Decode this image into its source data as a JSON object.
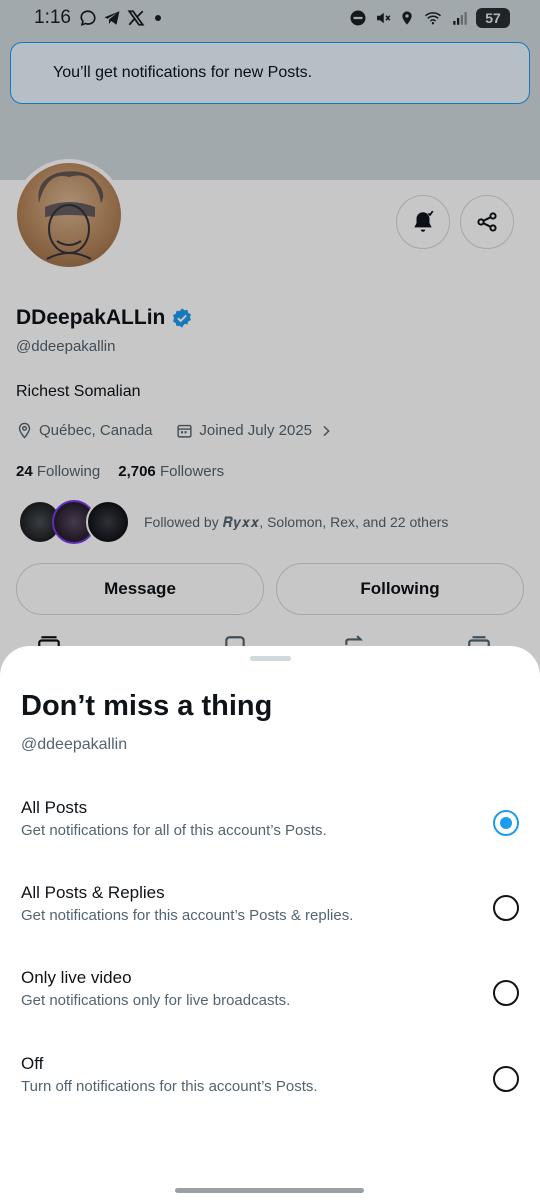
{
  "status_bar": {
    "time": "1:16",
    "battery": "57"
  },
  "toast": {
    "text": "You’ll get notifications for new Posts."
  },
  "profile": {
    "display_name": "DDeepakALLin",
    "handle": "@ddeepakallin",
    "bio": "Richest Somalian",
    "location": "Québec, Canada",
    "joined": "Joined July 2025",
    "following_count": "24",
    "following_label": "Following",
    "followers_count": "2,706",
    "followers_label": "Followers",
    "followed_by": "Followed by 𝑹𝒚𝒙𝒙, Solomon, Rex, and 22 others",
    "message_label": "Message",
    "following_button_label": "Following",
    "verified_color": "#1d9bf0"
  },
  "sheet": {
    "title": "Don’t miss a thing",
    "subtitle": "@ddeepakallin",
    "options": [
      {
        "title": "All Posts",
        "desc": "Get notifications for all of this account’s Posts.",
        "selected": true
      },
      {
        "title": "All Posts & Replies",
        "desc": "Get notifications for this account’s Posts & replies.",
        "selected": false
      },
      {
        "title": "Only live video",
        "desc": "Get notifications only for live broadcasts.",
        "selected": false
      },
      {
        "title": "Off",
        "desc": "Turn off notifications for this account’s Posts.",
        "selected": false
      }
    ]
  },
  "colors": {
    "accent": "#1d9bf0",
    "text": "#0f1419",
    "secondary_text": "#536471"
  }
}
